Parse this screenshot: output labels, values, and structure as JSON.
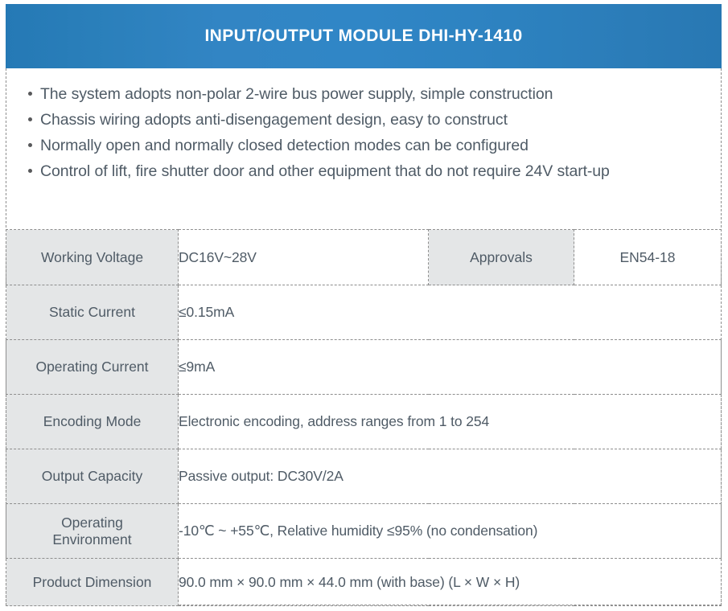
{
  "header": {
    "title": "INPUT/OUTPUT MODULE DHI-HY-1410",
    "background_color": "#2e82c0",
    "text_color": "#ffffff"
  },
  "features": {
    "bullets": [
      "The system adopts non-polar 2-wire bus power supply, simple construction",
      "Chassis wiring adopts anti-disengagement design, easy to construct",
      "Normally open and normally closed detection modes can be configured",
      "Control of lift, fire shutter door and other equipment that do not require 24V start-up"
    ]
  },
  "spec_table": {
    "label_background": "#e4e6e7",
    "text_color": "#4f5b66",
    "border_color": "#8e8e8e",
    "rows": [
      {
        "label": "Working Voltage",
        "value": "DC16V~28V",
        "extra_label": "Approvals",
        "extra_value": "EN54-18"
      },
      {
        "label": "Static Current",
        "value": "≤0.15mA"
      },
      {
        "label": "Operating Current",
        "value": "≤9mA"
      },
      {
        "label": "Encoding Mode",
        "value": "Electronic encoding, address ranges from 1 to 254"
      },
      {
        "label": "Output Capacity",
        "value": "Passive output: DC30V/2A"
      },
      {
        "label": "Operating Environment",
        "label_line1": "Operating",
        "label_line2": "Environment",
        "value": "-10℃ ~ +55℃, Relative humidity ≤95% (no condensation)"
      },
      {
        "label": "Product Dimension",
        "value": "90.0 mm × 90.0 mm × 44.0 mm (with base) (L × W × H)"
      }
    ]
  }
}
